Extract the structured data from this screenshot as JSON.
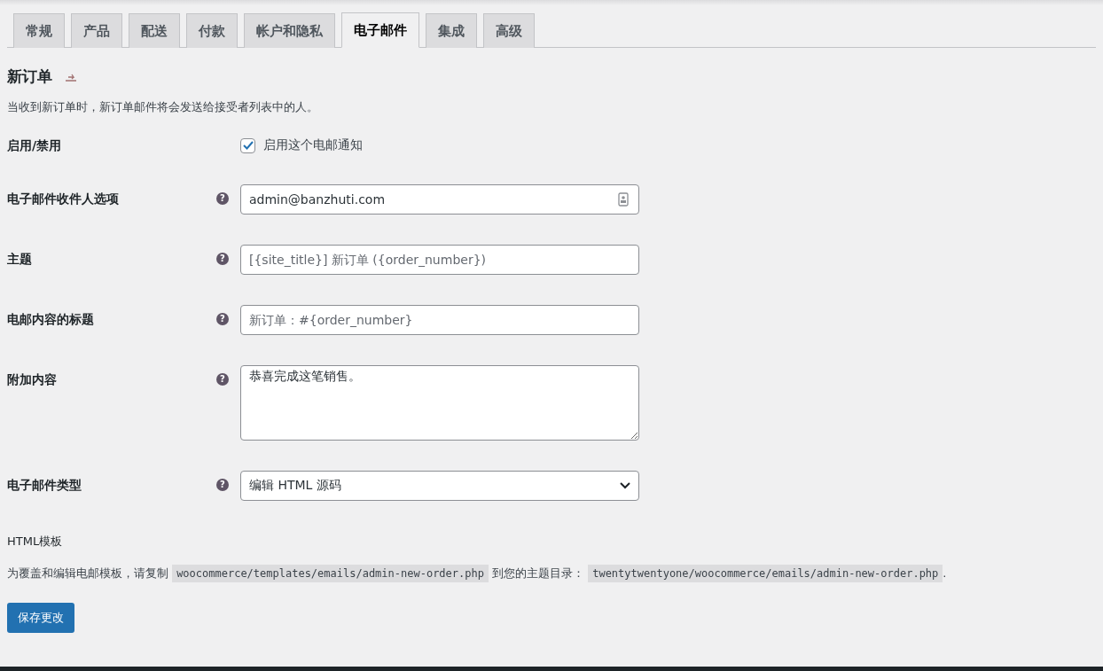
{
  "tabs": [
    {
      "label": "常规",
      "selected": false
    },
    {
      "label": "产品",
      "selected": false
    },
    {
      "label": "配送",
      "selected": false
    },
    {
      "label": "付款",
      "selected": false
    },
    {
      "label": "帐户和隐私",
      "selected": false
    },
    {
      "label": "电子邮件",
      "selected": true
    },
    {
      "label": "集成",
      "selected": false
    },
    {
      "label": "高级",
      "selected": false
    }
  ],
  "heading": {
    "title": "新订单"
  },
  "description": "当收到新订单时，新订单邮件将会发送给接受者列表中的人。",
  "fields": [
    {
      "kind": "checkbox",
      "label": "启用/禁用",
      "option": "启用这个电邮通知",
      "checked": true
    },
    {
      "kind": "text",
      "label": "电子邮件收件人选项",
      "help": "?",
      "value": "admin@banzhuti.com",
      "contact_icon": true
    },
    {
      "kind": "text",
      "label": "主题",
      "help": "?",
      "placeholder": "[{site_title}] 新订单 ({order_number})"
    },
    {
      "kind": "text",
      "label": "电邮内容的标题",
      "help": "?",
      "placeholder": "新订单：#{order_number}"
    },
    {
      "kind": "textarea",
      "label": "附加内容",
      "help": "?",
      "value": "恭喜完成这笔销售。"
    },
    {
      "kind": "select",
      "label": "电子邮件类型",
      "help": "?",
      "value": "编辑 HTML 源码"
    }
  ],
  "template": {
    "title": "HTML模板",
    "segments": [
      {
        "kind": "text",
        "text": "为覆盖和编辑电邮模板，请复制 "
      },
      {
        "kind": "code",
        "text": "woocommerce/templates/emails/admin-new-order.php"
      },
      {
        "kind": "text",
        "text": " 到您的主题目录： "
      },
      {
        "kind": "code",
        "text": "twentytwentyone/woocommerce/emails/admin-new-order.php"
      },
      {
        "kind": "text",
        "text": "."
      }
    ]
  },
  "save_button": "保存更改"
}
